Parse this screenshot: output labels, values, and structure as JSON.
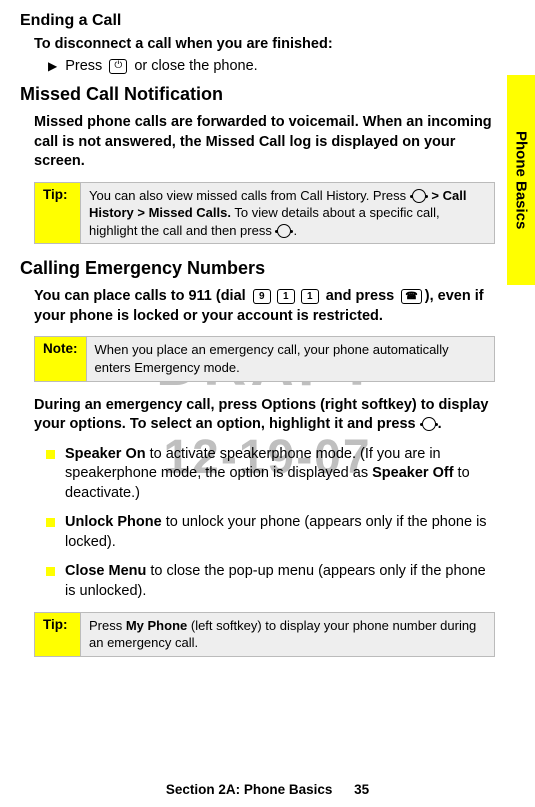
{
  "side_tab": "Phone Basics",
  "watermark1": "DRAFT",
  "watermark2": "12-19-07",
  "h_ending": "Ending a Call",
  "ending_instr": "To disconnect a call when you are finished:",
  "ending_action_prefix": "Press ",
  "ending_action_suffix": "  or close the phone.",
  "end_key_glyph": "⏻",
  "h_missed": "Missed Call Notification",
  "missed_body": "Missed phone calls are forwarded to voicemail. When an incoming call is not answered, the Missed Call log is displayed on your screen.",
  "tip1": {
    "label": "Tip:",
    "line1_prefix": "You can also view missed calls from Call History. Press ",
    "line1_bold": "Call History > Missed Calls.",
    "line2": " To view details about a specific call, highlight the call and then press ",
    "arrow": " > "
  },
  "h_emergency": "Calling Emergency Numbers",
  "emergency_body_prefix": "You can place calls to 911 (dial ",
  "emergency_keys": [
    "9",
    "1",
    "1"
  ],
  "emergency_body_mid": " and press ",
  "talk_key_glyph": "☎",
  "emergency_body_suffix": "), even if your phone is locked or your account is restricted.",
  "note1": {
    "label": "Note:",
    "body": "When you place an emergency call, your phone automatically enters Emergency mode."
  },
  "during_body_1": "During an emergency call, press ",
  "during_options": "Options",
  "during_body_2": " (right softkey) to display your options. To select an option, highlight it and press ",
  "during_body_3": ".",
  "items": [
    {
      "lead": "Speaker On",
      "mid": " to activate speakerphone mode. (If you are in speakerphone mode, the option is displayed as ",
      "bold2": "Speaker Off",
      "tail": " to deactivate.)"
    },
    {
      "lead": "Unlock Phone",
      "mid": " to unlock your phone (appears only if the phone is locked).",
      "bold2": "",
      "tail": ""
    },
    {
      "lead": "Close Menu",
      "mid": " to close the pop-up menu (appears only if the phone is unlocked).",
      "bold2": "",
      "tail": ""
    }
  ],
  "tip2": {
    "label": "Tip:",
    "prefix": "Press ",
    "bold": "My Phone",
    "suffix": " (left softkey) to display your phone number during an emergency call."
  },
  "footer": {
    "section": "Section 2A: Phone Basics",
    "page": "35"
  }
}
